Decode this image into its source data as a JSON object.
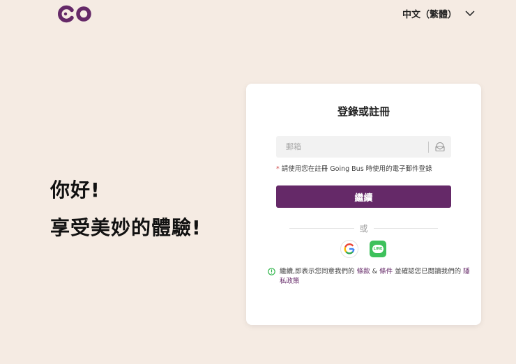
{
  "header": {
    "logo_text": "GO",
    "language_label": "中文（繁體）"
  },
  "hero": {
    "line1": "你好!",
    "line2": "享受美妙的體驗!"
  },
  "login_card": {
    "title": "登錄或註冊",
    "email": {
      "placeholder": "郵箱",
      "value": ""
    },
    "hint_marker": "*",
    "hint_text": "請使用您在註冊 Going Bus 時使用的電子郵件登錄",
    "continue_label": "繼續",
    "or_label": "或",
    "social": [
      {
        "name": "google",
        "icon": "google-icon"
      },
      {
        "name": "line",
        "icon": "line-icon",
        "label": "LINE"
      }
    ],
    "terms": {
      "prefix": "繼續,即表示您同意我們的",
      "terms_link": "條款",
      "amp": "&",
      "conditions_link": "條件",
      "middle": "並確認您已閱讀我們的",
      "privacy_link": "隱私政策"
    }
  },
  "colors": {
    "background": "#f5ebe3",
    "brand": "#652968",
    "line_green": "#3ec15c",
    "info_green": "#2fb54a"
  }
}
